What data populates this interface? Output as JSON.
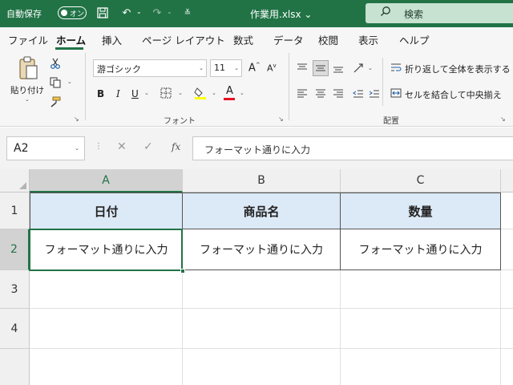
{
  "titlebar": {
    "autosave_label": "自動保存",
    "autosave_toggle": "オン",
    "filename": "作業用.xlsx ⌄",
    "search_placeholder": "検索"
  },
  "menu": {
    "tabs": [
      "ファイル",
      "ホーム",
      "挿入",
      "ページ レイアウト",
      "数式",
      "データ",
      "校閲",
      "表示",
      "ヘルプ"
    ],
    "active": "ホーム"
  },
  "ribbon": {
    "clipboard": {
      "paste_label": "貼り付け"
    },
    "font": {
      "group_label": "フォント",
      "font_name": "游ゴシック",
      "font_size": "11",
      "grow_label": "A",
      "shrink_label": "A",
      "bold": "B",
      "italic": "I",
      "underline": "U",
      "font_color_letter": "A",
      "highlight_color": "#ffff00",
      "font_color": "#e81123"
    },
    "alignment": {
      "group_label": "配置",
      "wrap_text": "折り返して全体を表示する",
      "merge_center": "セルを結合して中央揃え"
    }
  },
  "formula_bar": {
    "name_box": "A2",
    "fx_label": "fx",
    "content": "フォーマット通りに入力"
  },
  "sheet": {
    "columns": [
      "A",
      "B",
      "C"
    ],
    "rows": [
      "1",
      "2",
      "3",
      "4"
    ],
    "header_row": [
      "日付",
      "商品名",
      "数量"
    ],
    "data_row": [
      "フォーマット通りに入力",
      "フォーマット通りに入力",
      "フォーマット通りに入力"
    ],
    "selected_cell": "A2"
  },
  "colors": {
    "accent": "#217346",
    "header_fill": "#dce9f6"
  }
}
